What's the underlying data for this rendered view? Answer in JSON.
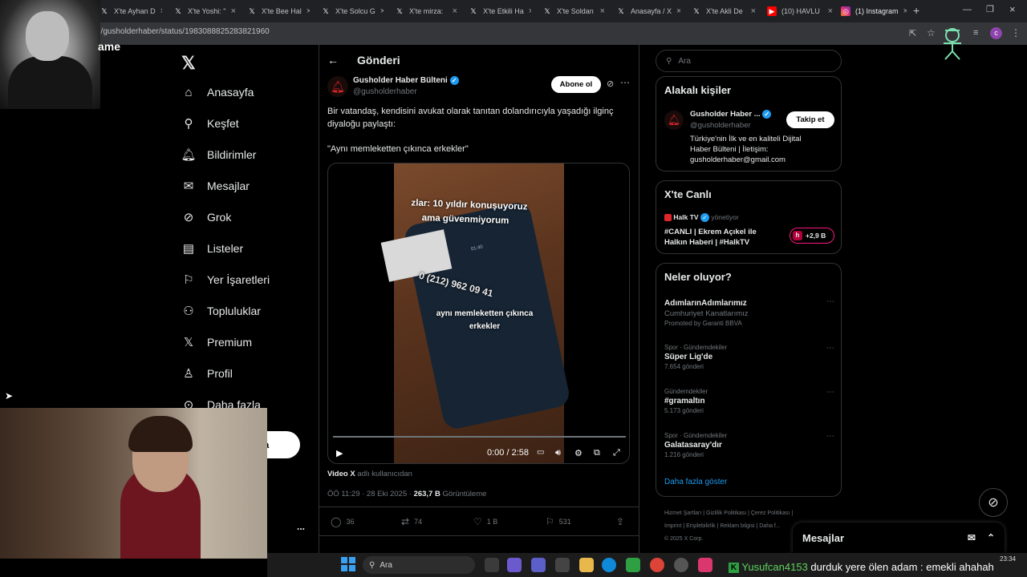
{
  "browser": {
    "tabs": [
      {
        "label": "X'te Ayhan D",
        "favicon": "x-icon"
      },
      {
        "label": "X'te Yoshi: \"",
        "favicon": "x-icon"
      },
      {
        "label": "X'te Bee Hal",
        "favicon": "x-icon"
      },
      {
        "label": "X'te Solcu G",
        "favicon": "x-icon"
      },
      {
        "label": "X'te mirza: ",
        "favicon": "x-icon"
      },
      {
        "label": "X'te Etkili Ha",
        "favicon": "x-icon"
      },
      {
        "label": "X'te Soldan",
        "favicon": "x-icon"
      },
      {
        "label": "Anasayfa / X",
        "favicon": "x-icon"
      },
      {
        "label": "X'te Akli De",
        "favicon": "x-icon"
      },
      {
        "label": "(10) HAVLU",
        "favicon": "youtube-icon"
      },
      {
        "label": "(1) Instagram",
        "favicon": "instagram-icon"
      }
    ],
    "new_tab": "+",
    "url": "n/gusholderhaber/status/1983088825283821960",
    "profile_initial": "c",
    "overlay_text": "ame"
  },
  "nav": {
    "items": [
      {
        "label": "Anasayfa",
        "icon": "home-icon"
      },
      {
        "label": "Keşfet",
        "icon": "search-icon"
      },
      {
        "label": "Bildirimler",
        "icon": "bell-icon"
      },
      {
        "label": "Mesajlar",
        "icon": "mail-icon"
      },
      {
        "label": "Grok",
        "icon": "grok-icon"
      },
      {
        "label": "Listeler",
        "icon": "list-icon"
      },
      {
        "label": "Yer İşaretleri",
        "icon": "bookmark-icon"
      },
      {
        "label": "Topluluklar",
        "icon": "communities-icon"
      },
      {
        "label": "Premium",
        "icon": "x-premium-icon"
      },
      {
        "label": "Profil",
        "icon": "profile-icon"
      },
      {
        "label": "Daha fazla",
        "icon": "more-icon"
      }
    ],
    "post_button": "a",
    "more_dots": "..."
  },
  "post": {
    "header": "Gönderi",
    "author_name": "Gusholder Haber Bülteni",
    "author_handle": "@gusholderhaber",
    "subscribe_label": "Abone ol",
    "text_line1": "Bir vatandaş, kendisini avukat olarak tanıtan dolandırıcıyla yaşadığı ilginç diyaloğu paylaştı:",
    "text_line2": "\"Aynı memleketten çıkınca erkekler\"",
    "video": {
      "caption_top_1": "zlar: 10 yıldır konuşuyoruz",
      "caption_top_2": "ama güvenmiyorum",
      "phone_number": "0 (212) 962 09 41",
      "phone_time": "01:40",
      "caption_mid_1": "aynı memleketten çıkınca",
      "caption_mid_2": "erkekler",
      "time": "0:00 / 2:58",
      "progress": 0.0
    },
    "video_source_bold": "Video X",
    "video_source_rest": "adlı kullanıcıdan",
    "timestamp": "ÖÖ 11:29 · 28 Eki 2025 ·",
    "views_count": "263,7 B",
    "views_label": "Görüntüleme",
    "stats": {
      "replies": "36",
      "reposts": "74",
      "likes": "1 B",
      "bookmarks": "531"
    }
  },
  "right": {
    "search_placeholder": "Ara",
    "related": {
      "title": "Alakalı kişiler",
      "name": "Gusholder Haber ...",
      "handle": "@gusholderhaber",
      "follow_label": "Takip et",
      "bio_1": "Türkiye'nin İlk ve en kaliteli Dijital",
      "bio_2": "Haber Bülteni | İletişim:",
      "bio_3": "gusholderhaber@gmail.com"
    },
    "live": {
      "title": "X'te Canlı",
      "host": "Halk TV",
      "host_suffix": "yönetiyor",
      "headline_1": "#CANLI | Ekrem Açıkel ile",
      "headline_2": "Halkın Haberi | #HalkTV",
      "listeners": "+2,9 B"
    },
    "trends": {
      "title": "Neler oluyor?",
      "items": [
        {
          "meta": "",
          "name": "AdımlarınAdımlarımız",
          "sub": "Cumhuriyet Kanatlarımız",
          "count": "Promoted by Garanti BBVA"
        },
        {
          "meta": "Spor · Gündemdekiler",
          "name": "Süper Lig'de",
          "sub": "",
          "count": "7.654 gönderi"
        },
        {
          "meta": "Gündemdekiler",
          "name": "#gramaltın",
          "sub": "",
          "count": "5.173 gönderi"
        },
        {
          "meta": "Spor · Gündemdekiler",
          "name": "Galatasaray'dır",
          "sub": "",
          "count": "1.216 gönderi"
        }
      ],
      "show_more": "Daha fazla göster"
    },
    "footer_1": "Hizmet Şartları  |  Gizlilik Politikası  |  Çerez Politikası  |",
    "footer_2": "Imprint  |  Erişilebilirlik  |  Reklam bilgisi  |  Daha f...",
    "footer_3": "© 2025 X Corp.",
    "messages_label": "Mesajlar"
  },
  "taskbar": {
    "search_label": "Ara",
    "ticker_user": "Yusufcan4153",
    "ticker_text": "durduk yere ölen adam : emekli ahahah",
    "clock": "23:34"
  },
  "colors": {
    "accent": "#1d9bf0",
    "live_pink": "#f91880",
    "bg": "#000000"
  }
}
